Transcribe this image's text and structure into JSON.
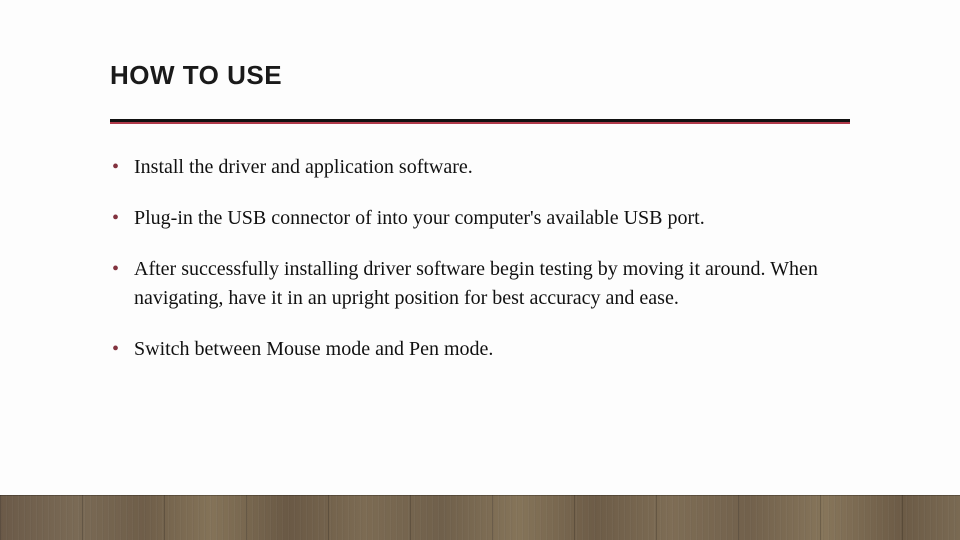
{
  "slide": {
    "title": "HOW TO USE",
    "bullets": [
      "Install the driver and application software.",
      "Plug-in the USB  connector  of into your computer's available USB port.",
      "After successfully installing driver software begin testing by moving it around. When navigating, have it in an upright position for best accuracy and ease.",
      " Switch between Mouse mode and Pen mode."
    ],
    "accent_color": "#b03a4a",
    "bullet_color": "#82323e"
  }
}
